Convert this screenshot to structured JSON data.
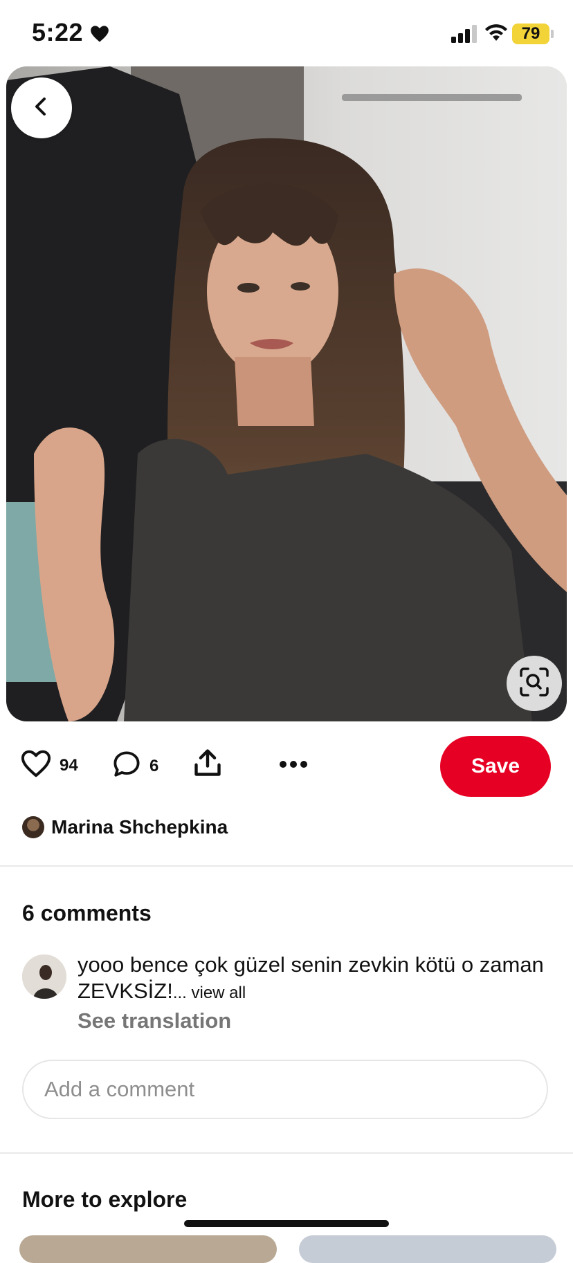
{
  "status_bar": {
    "time": "5:22",
    "battery": "79"
  },
  "pin": {
    "like_count": "94",
    "comment_count": "6"
  },
  "actions": {
    "save_label": "Save"
  },
  "creator": {
    "name": "Marina Shchepkina"
  },
  "comments": {
    "title": "6 comments",
    "first": {
      "text": "yooo bence çok güzel senin zevkin kötü o zaman ZEVKSİZ!",
      "ellipsis": "... ",
      "view_all": "view all",
      "see_translation": "See translation"
    },
    "input_placeholder": "Add a comment"
  },
  "explore": {
    "title": "More to explore"
  },
  "colors": {
    "save": "#e60023",
    "battery": "#f2d338"
  },
  "icons": [
    "heart-icon",
    "comment-icon",
    "share-icon",
    "more-icon",
    "back-icon",
    "visual-search-icon"
  ]
}
